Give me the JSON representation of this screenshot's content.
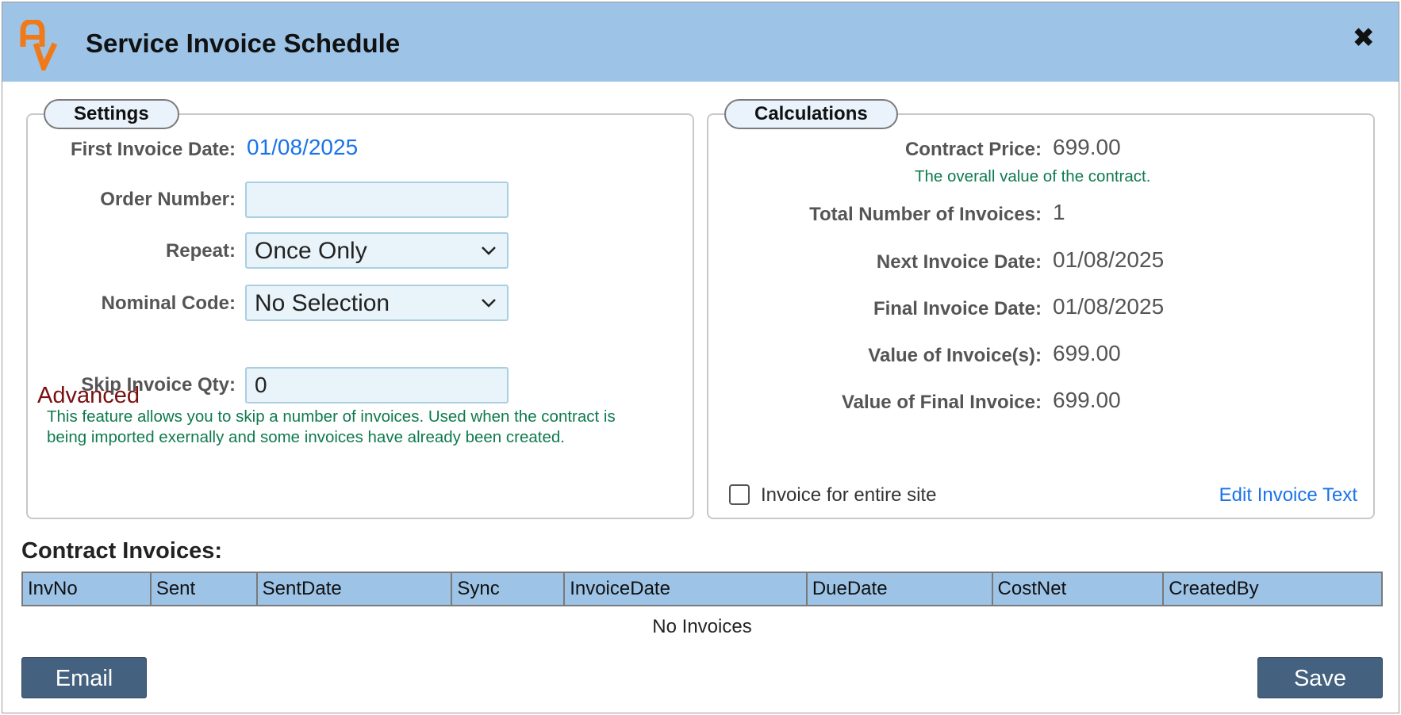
{
  "dialog": {
    "title": "Service Invoice Schedule",
    "close_glyph": "✖",
    "logo_icon": "av-logo-icon",
    "logo_color": "#f07a1a"
  },
  "settings": {
    "legend": "Settings",
    "first_invoice_date_label": "First Invoice Date:",
    "first_invoice_date_value": "01/08/2025",
    "order_number_label": "Order Number:",
    "order_number_value": "",
    "repeat_label": "Repeat:",
    "repeat_value": "Once Only",
    "nominal_code_label": "Nominal Code:",
    "nominal_code_value": "No Selection",
    "advanced_heading": "Advanced",
    "skip_invoice_qty_label": "Skip Invoice Qty:",
    "skip_invoice_qty_value": "0",
    "skip_help_line1": "This feature allows you to skip a number of invoices. Used when the contract is",
    "skip_help_line2": "being imported exernally and some invoices have already been created."
  },
  "calculations": {
    "legend": "Calculations",
    "contract_price_label": "Contract Price:",
    "contract_price_value": "699.00",
    "contract_price_help": "The overall value of the contract.",
    "total_invoices_label": "Total Number of Invoices:",
    "total_invoices_value": "1",
    "next_invoice_date_label": "Next Invoice Date:",
    "next_invoice_date_value": "01/08/2025",
    "final_invoice_date_label": "Final Invoice Date:",
    "final_invoice_date_value": "01/08/2025",
    "value_of_invoices_label": "Value of Invoice(s):",
    "value_of_invoices_value": "699.00",
    "value_of_final_label": "Value of Final Invoice:",
    "value_of_final_value": "699.00",
    "entire_site_label": "Invoice for entire site",
    "entire_site_checked": false,
    "edit_invoice_text_link": "Edit Invoice Text"
  },
  "invoices": {
    "title": "Contract Invoices:",
    "columns": [
      "InvNo",
      "Sent",
      "SentDate",
      "Sync",
      "InvoiceDate",
      "DueDate",
      "CostNet",
      "CreatedBy"
    ],
    "empty_message": "No Invoices"
  },
  "footer": {
    "email_label": "Email",
    "save_label": "Save"
  },
  "colors": {
    "header_bg": "#9dc3e6",
    "button_bg": "#44617f",
    "link": "#1a73e8",
    "help_text": "#0f7a4f",
    "advanced_heading": "#7a1010"
  }
}
